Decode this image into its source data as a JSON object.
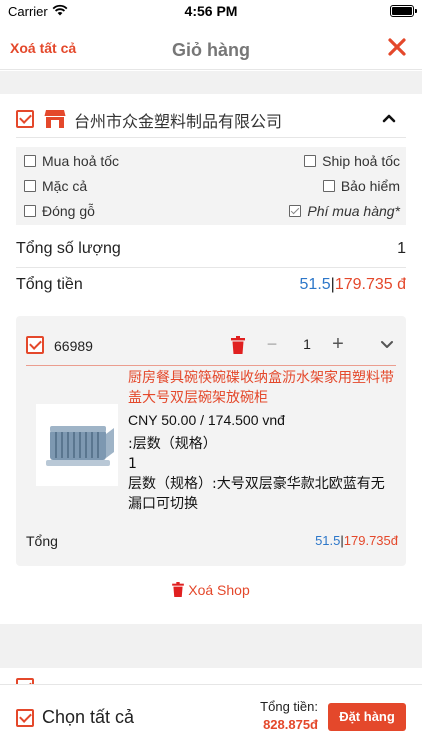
{
  "status_bar": {
    "carrier": "Carrier",
    "time": "4:56 PM"
  },
  "header": {
    "clear_all": "Xoá tất cả",
    "title": "Giỏ hàng"
  },
  "shop": {
    "name": "台州市众金塑料制品有限公司",
    "options": [
      {
        "label": "Mua hoả tốc",
        "checked": false
      },
      {
        "label": "Ship hoả tốc",
        "checked": false
      },
      {
        "label": "Mặc cả",
        "checked": false
      },
      {
        "label": "Bảo hiểm",
        "checked": false
      },
      {
        "label": "Đóng gỗ",
        "checked": false
      },
      {
        "label": "Phí mua hàng*",
        "checked": true
      }
    ],
    "total_quantity_label": "Tổng số lượng",
    "total_quantity": "1",
    "total_amount_label": "Tổng tiền",
    "total_cny": "51.5",
    "total_vnd": "179.735 đ",
    "delete_shop": "Xoá Shop"
  },
  "item": {
    "code": "66989",
    "quantity": "1",
    "name": "厨房餐具碗筷碗碟收纳盒沥水架家用塑料带盖大号双层碗架放碗柜",
    "price": "CNY 50.00 / 174.500 vnđ",
    "attr_line1": ":层数（规格）",
    "attr_line2": "1",
    "attr_line3": "层数（规格）:大号双层豪华款北欧蓝有无漏口可切换",
    "total_label": "Tổng",
    "total_cny": "51.5",
    "total_vnd": "179.735đ"
  },
  "footer": {
    "select_all": "Chọn tất cả",
    "total_label": "Tổng tiền:",
    "total_value": "828.875đ",
    "order_button": "Đặt hàng"
  },
  "colors": {
    "accent": "#e4482b",
    "blue": "#2d77c9"
  }
}
